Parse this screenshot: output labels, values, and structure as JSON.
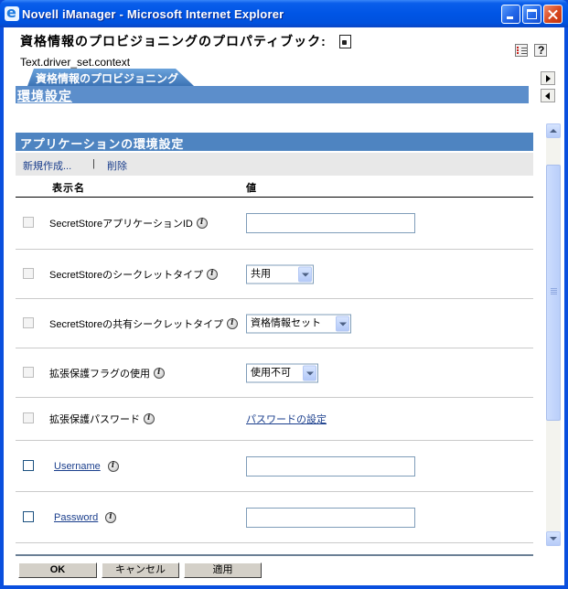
{
  "window": {
    "title": "Novell iManager - Microsoft Internet Explorer"
  },
  "header": {
    "title": "資格情報のプロビジョニングのプロパティブック:",
    "context": "Text.driver_set.context"
  },
  "tab": {
    "label": "資格情報のプロビジョニング"
  },
  "subpage": {
    "label": "環境設定"
  },
  "section": {
    "title": "アプリケーションの環境設定"
  },
  "toolbar": {
    "new_label": "新規作成...",
    "separator": "|",
    "delete_label": "削除"
  },
  "columns": {
    "name": "表示名",
    "value": "値"
  },
  "rows": [
    {
      "label": "SecretStoreアプリケーションID",
      "control": "text",
      "value": ""
    },
    {
      "label": "SecretStoreのシークレットタイプ",
      "control": "select",
      "value": "共用"
    },
    {
      "label": "SecretStoreの共有シークレットタイプ",
      "control": "select",
      "value": "資格情報セット"
    },
    {
      "label": "拡張保護フラグの使用",
      "control": "select",
      "value": "使用不可"
    },
    {
      "label": "拡張保護パスワード",
      "control": "link",
      "value": "パスワードの設定"
    },
    {
      "label": "Username",
      "control": "text",
      "value": ""
    },
    {
      "label": "Password",
      "control": "text",
      "value": ""
    }
  ],
  "buttons": {
    "ok": "OK",
    "cancel": "キャンセル",
    "apply": "適用"
  },
  "icons": {
    "window": "ie-icon",
    "window_controls": [
      "minimize-icon",
      "maximize-icon",
      "close-icon"
    ],
    "header": "page-help-icon",
    "top_right": [
      "task-list-icon",
      "help-icon"
    ],
    "tab_nav": [
      "next-tab-icon",
      "prev-tab-icon"
    ],
    "row_help": "info-icon"
  },
  "colors": {
    "title_bar": "#0055E5",
    "tab": "#4A80C0",
    "subpage_bar": "#5C8ECB",
    "section_header": "#4E84C1",
    "toolbar_bg": "#E8E8E8",
    "link": "#1A3E8C"
  }
}
